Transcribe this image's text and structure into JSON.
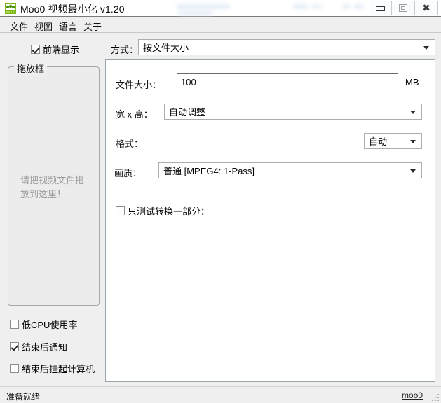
{
  "window": {
    "title": "Moo0 视频最小化 v1.20",
    "icon": "app-logo-icon",
    "controls": {
      "minimize": "minimize-icon",
      "maximize": "maximize-icon",
      "close": "close-icon"
    }
  },
  "menubar": {
    "items": [
      {
        "label": "文件"
      },
      {
        "label": "视图"
      },
      {
        "label": "语言"
      },
      {
        "label": "关于"
      }
    ]
  },
  "toolbar": {
    "always_on_top": {
      "label": "前端显示",
      "checked": true
    },
    "mode_label": "方式：",
    "mode_value": "按文件大小"
  },
  "dropbox": {
    "group_title": "拖放框",
    "hint": "请把视频文件拖放到这里！"
  },
  "left_options": [
    {
      "label": "低CPU使用率",
      "checked": false
    },
    {
      "label": "结束后通知",
      "checked": true
    },
    {
      "label": "结束后挂起计算机",
      "checked": false
    }
  ],
  "settings": {
    "file_size": {
      "label": "文件大小：",
      "value": "100",
      "placeholder": "",
      "unit": "MB"
    },
    "dimensions": {
      "label": "宽 x 高：",
      "value": "自动调整"
    },
    "format": {
      "label": "格式：",
      "value": "自动"
    },
    "quality": {
      "label": "画质：",
      "value": "普通  [MPEG4: 1-Pass]"
    },
    "partial_test": {
      "label": "只测试转换一部分：",
      "checked": false
    }
  },
  "statusbar": {
    "status": "准备就绪",
    "link": "moo0"
  }
}
